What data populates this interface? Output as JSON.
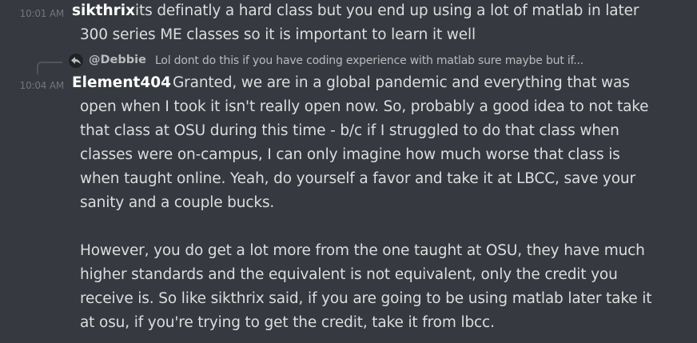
{
  "messages": [
    {
      "timestamp": "10:01 AM",
      "author": "sikthrix",
      "lines": [
        "its definatly a hard class but you end up using a lot of matlab in later",
        "300 series ME classes so it is important to learn it well"
      ]
    },
    {
      "reply": {
        "icon": "reply-arrow-icon",
        "author": "@Debbie",
        "text": "Lol dont do this if you have coding experience with matlab sure maybe  but if..."
      },
      "timestamp": "10:04 AM",
      "author": "Element404",
      "lines": [
        "Granted, we are in a global pandemic and everything that was",
        "open when I took it isn't really open now. So, probably a good idea to not take",
        "that class at OSU during this time - b/c if I struggled to do that class when",
        "classes were on-campus, I can only imagine how much worse that class is",
        "when taught online. Yeah, do yourself a favor and take it at LBCC, save your",
        "sanity and a couple bucks.",
        "However, you do get a lot more from the one taught at OSU, they have much",
        "higher standards and the equivalent is not equivalent, only the credit you",
        "receive is. So like sikthrix said, if you are going to be using matlab later take it",
        "at osu, if you're trying to get the credit, take it from lbcc."
      ]
    }
  ],
  "colors": {
    "background": "#36393f",
    "timestamp": "#72767d",
    "author": "#ffffff",
    "message_text": "#dcddde",
    "reply_text": "#b9bbbe"
  }
}
